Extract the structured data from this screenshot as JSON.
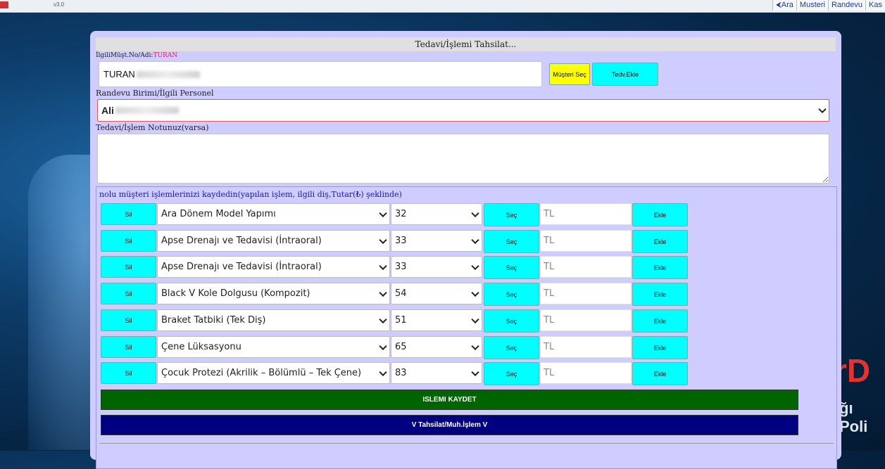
{
  "topbar": {
    "small_label": "v3.0",
    "nav": [
      "Ara",
      "Musteri",
      "Randevu",
      "Kas"
    ]
  },
  "brand": {
    "text1": "rD",
    "text2": "ğı Poli"
  },
  "form": {
    "title": "Tedavi/İşlemi Tahsilat...",
    "customer_label": "İlgiliMüşt.No/Adi:",
    "customer_label_value": "TURAN",
    "customer_name": "TURAN",
    "select_customer_button": "Müşteri Seç",
    "add_treatment_button": "Tedv.Ekle",
    "staff_label": "Randevu Birimi/İlgili Personel",
    "staff_value": "Ali",
    "note_label": "Tedavi/İşlem Notunuz(varsa)",
    "note_value": ""
  },
  "operations": {
    "header": "nolu müşteri işlemlerinizi kaydedin(yapılan işlem, ilgili diş,Tutar(₺) şeklinde)",
    "delete_label": "Sil",
    "choose_label": "Seç",
    "add_label": "Ekle",
    "amount_placeholder": "TL",
    "rows": [
      {
        "procedure": "Ara Dönem Model Yapımı",
        "tooth": "32"
      },
      {
        "procedure": "Apse Drenajı ve Tedavisi (İntraoral)",
        "tooth": "33"
      },
      {
        "procedure": "Apse Drenajı ve Tedavisi (İntraoral)",
        "tooth": "33"
      },
      {
        "procedure": "Black V Kole Dolgusu (Kompozit)",
        "tooth": "54"
      },
      {
        "procedure": "Braket Tatbiki (Tek Diş)",
        "tooth": "51"
      },
      {
        "procedure": "Çene Lüksasyonu",
        "tooth": "65"
      },
      {
        "procedure": "Çocuk Protezi (Akrilik – Bölümlü – Tek Çene)",
        "tooth": "83"
      }
    ],
    "save_button": "ISLEMI KAYDET",
    "payment_button": "V Tahsilat/Muh.İşlem V"
  },
  "colors": {
    "panel": "#cfccff",
    "cyan_button": "#00ffff",
    "yellow_button": "#ffff00",
    "save_bar": "#006400",
    "payment_bar": "#000080"
  }
}
